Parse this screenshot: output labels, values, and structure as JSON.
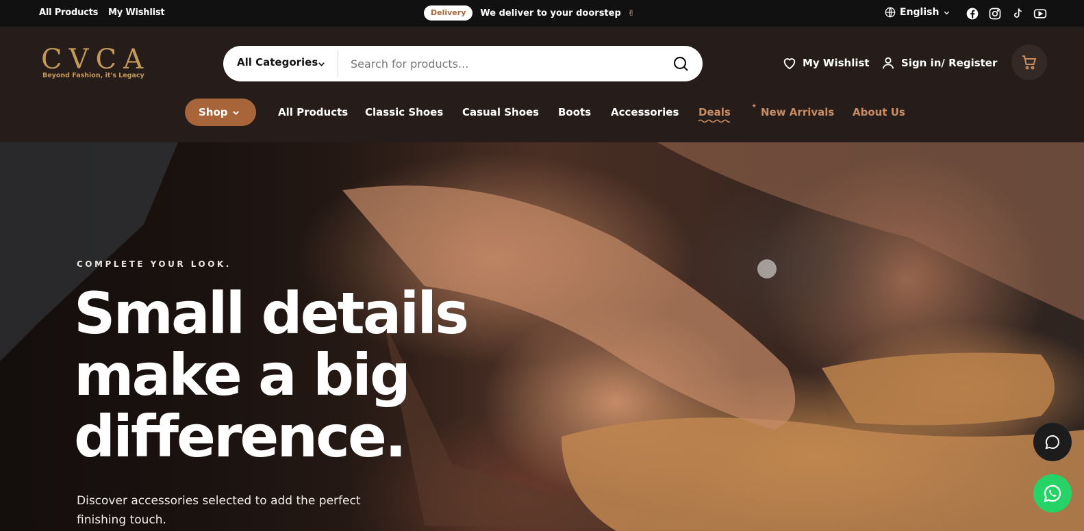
{
  "topbar": {
    "link_all_products": "All Products",
    "link_wishlist": "My Wishlist",
    "promo_badge": "Delivery",
    "promo_text": "We deliver to your doorstep",
    "promo_emoji": "✌",
    "language": "English",
    "social_icons": [
      "facebook-icon",
      "instagram-icon",
      "tiktok-icon",
      "youtube-icon"
    ]
  },
  "header": {
    "logo_text": "CVCA",
    "logo_tagline": "Beyond Fashion, it's Legacy",
    "search": {
      "category": "All Categories",
      "placeholder": "Search for products..."
    },
    "wishlist_label": "My Wishlist",
    "signin_label": "Sign in/ Register"
  },
  "nav": {
    "shop_label": "Shop",
    "items": [
      "All Products",
      "Classic Shoes",
      "Casual Shoes",
      "Boots",
      "Accessories",
      "Deals",
      "New Arrivals",
      "About Us"
    ]
  },
  "hero": {
    "eyebrow": "COMPLETE YOUR LOOK.",
    "headline_1": "Small details",
    "headline_2": "make a big",
    "headline_3": "difference.",
    "subtext": "Discover accessories selected to add the perfect finishing touch."
  },
  "colors": {
    "accent": "#a9653a",
    "nav_accent": "#c98d64",
    "gold_logo": "#c49a5b",
    "topbar_bg": "#111111",
    "header_bg": "#261c19",
    "whatsapp": "#25d366"
  }
}
